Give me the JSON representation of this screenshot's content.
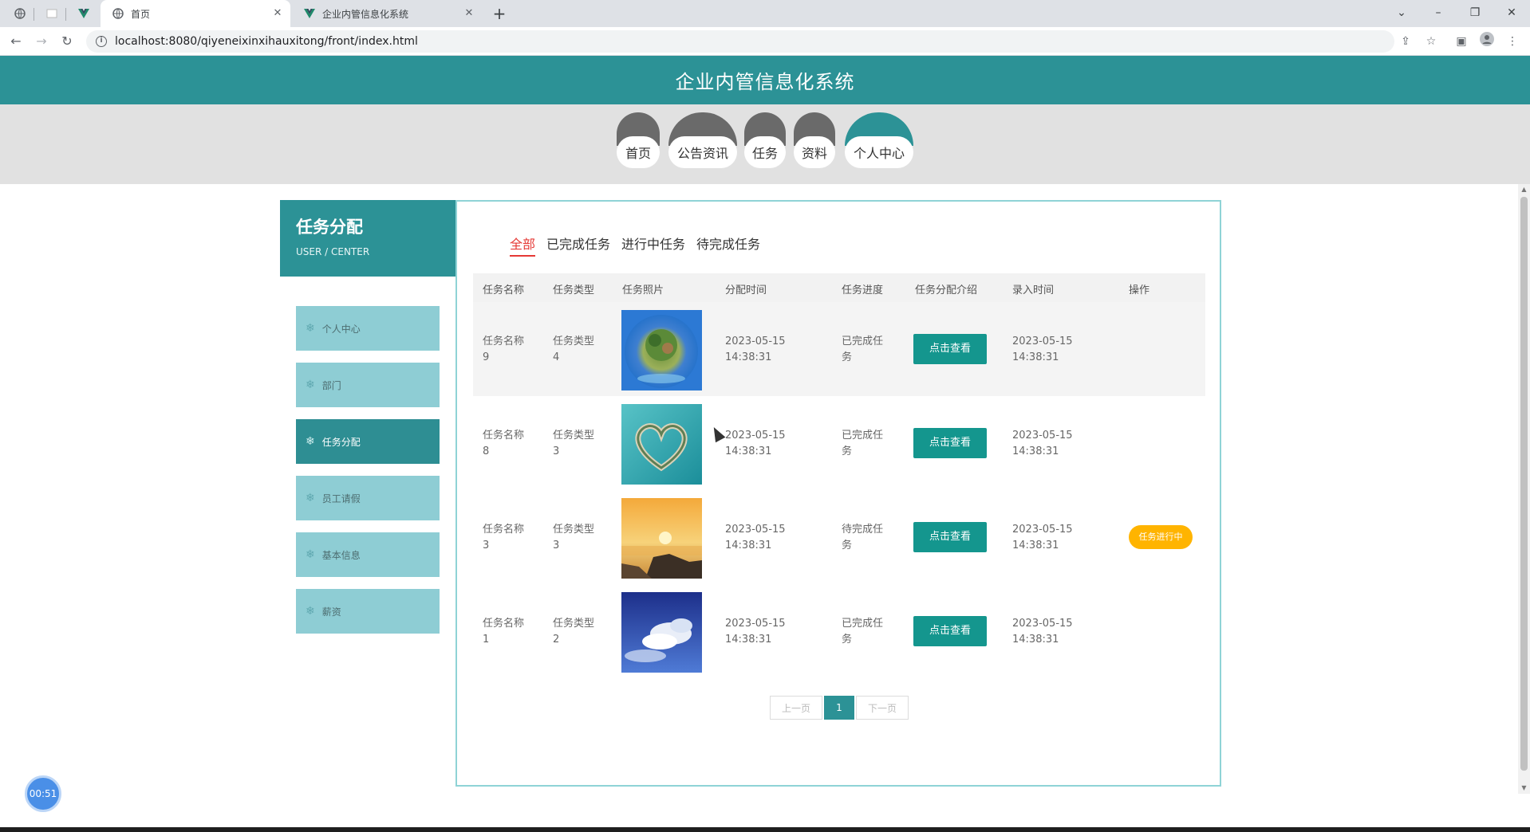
{
  "browser": {
    "tabs": [
      {
        "label": "首页",
        "active": true
      },
      {
        "label": "企业内管信息化系统",
        "active": false
      }
    ],
    "url": "localhost:8080/qiyeneixinxihauxitong/front/index.html"
  },
  "site": {
    "title": "企业内管信息化系统",
    "menu": [
      "首页",
      "公告资讯",
      "任务",
      "资料",
      "个人中心"
    ],
    "active_menu": "个人中心"
  },
  "sidebar": {
    "title": "任务分配",
    "subtitle": "USER / CENTER",
    "items": [
      "个人中心",
      "部门",
      "任务分配",
      "员工请假",
      "基本信息",
      "薪资"
    ],
    "active_item": "任务分配"
  },
  "filters": {
    "items": [
      "全部",
      "已完成任务",
      "进行中任务",
      "待完成任务"
    ],
    "active": "全部"
  },
  "table": {
    "headers": [
      "任务名称",
      "任务类型",
      "任务照片",
      "分配时间",
      "任务进度",
      "任务分配介绍",
      "录入时间",
      "操作"
    ],
    "view_label": "点击查看",
    "rows": [
      {
        "name_line1": "任务名称",
        "name_line2": "9",
        "type_line1": "任务类型",
        "type_line2": "4",
        "time_line1": "2023-05-15",
        "time_line2": "14:38:31",
        "progress_line1": "已完成任",
        "progress_line2": "务",
        "entry_line1": "2023-05-15",
        "entry_line2": "14:38:31",
        "badge": "",
        "photo": "planet-island"
      },
      {
        "name_line1": "任务名称",
        "name_line2": "8",
        "type_line1": "任务类型",
        "type_line2": "3",
        "time_line1": "2023-05-15",
        "time_line2": "14:38:31",
        "progress_line1": "已完成任",
        "progress_line2": "务",
        "entry_line1": "2023-05-15",
        "entry_line2": "14:38:31",
        "badge": "",
        "photo": "heart-island"
      },
      {
        "name_line1": "任务名称",
        "name_line2": "3",
        "type_line1": "任务类型",
        "type_line2": "3",
        "time_line1": "2023-05-15",
        "time_line2": "14:38:31",
        "progress_line1": "待完成任",
        "progress_line2": "务",
        "entry_line1": "2023-05-15",
        "entry_line2": "14:38:31",
        "badge": "任务进行中",
        "photo": "sunset-coast"
      },
      {
        "name_line1": "任务名称",
        "name_line2": "1",
        "type_line1": "任务类型",
        "type_line2": "2",
        "time_line1": "2023-05-15",
        "time_line2": "14:38:31",
        "progress_line1": "已完成任",
        "progress_line2": "务",
        "entry_line1": "2023-05-15",
        "entry_line2": "14:38:31",
        "badge": "",
        "photo": "blue-sky-clouds"
      }
    ]
  },
  "pager": {
    "prev": "上一页",
    "current": "1",
    "next": "下一页"
  },
  "timer": "00:51",
  "colors": {
    "primary": "#2c9296",
    "button": "#14968e",
    "badge": "#ffb400",
    "sidebar_item": "#8ecdd4",
    "active_filter": "#e53935"
  }
}
